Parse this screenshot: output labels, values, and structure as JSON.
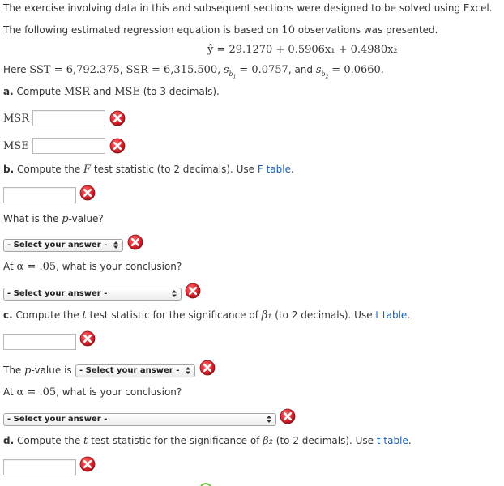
{
  "intro": {
    "line1": "The exercise involving data in this and subsequent sections were designed to be solved using Excel.",
    "line2": "The following estimated regression equation is based on ",
    "n": "10",
    "line2b": " observations was presented."
  },
  "equation": "ŷ = 29.1270 + 0.5906x₁ + 0.4980x₂",
  "stats": {
    "here": "Here ",
    "sst": "SST = 6,792.375",
    "ssr": "SSR = 6,315.500",
    "sb1": "= 0.0757",
    "and": ", and ",
    "sb2": "= 0.0660."
  },
  "part_a": {
    "prefix": "a.",
    "text": " Compute ",
    "msr": "MSR",
    "and": " and ",
    "mse": "MSE",
    "suffix": " (to 3 decimals).",
    "msr_label": "MSR",
    "mse_label": "MSE"
  },
  "part_b": {
    "prefix": "b.",
    "text1": " Compute the ",
    "F": "F",
    "text2": " test statistic (to 2 decimals). Use ",
    "link": "F table",
    "end": ".",
    "pvalue_q1": "What is the ",
    "p": "p",
    "pvalue_q2": "-value?",
    "select1": "- Select your answer -",
    "alpha_q1": "At ",
    "alpha": "α = .05",
    "alpha_q2": ", what is your conclusion?",
    "select2": "- Select your answer -"
  },
  "part_c": {
    "prefix": "c.",
    "text1": " Compute the ",
    "t": "t",
    "text2": " test statistic for the significance of ",
    "beta": "β₁",
    "text3": " (to 2 decimals). Use ",
    "link": "t table",
    "end": ".",
    "pvalue1": "The ",
    "p": "p",
    "pvalue2": "-value is",
    "select1": "- Select your answer -",
    "alpha_q1": "At ",
    "alpha": "α = .05",
    "alpha_q2": ", what is your conclusion?",
    "select2": "- Select your answer -"
  },
  "part_d": {
    "prefix": "d.",
    "text1": " Compute the ",
    "t": "t",
    "text2": " test statistic for the significance of ",
    "beta": "β₂",
    "text3": " (to 2 decimals). Use ",
    "link": "t table",
    "end": "."
  },
  "colors": {
    "error_red": "#d9232d",
    "link_blue": "#1a5fb4"
  },
  "icons": {
    "error": "error-x-icon",
    "dropdown": "dropdown-arrows-icon"
  }
}
